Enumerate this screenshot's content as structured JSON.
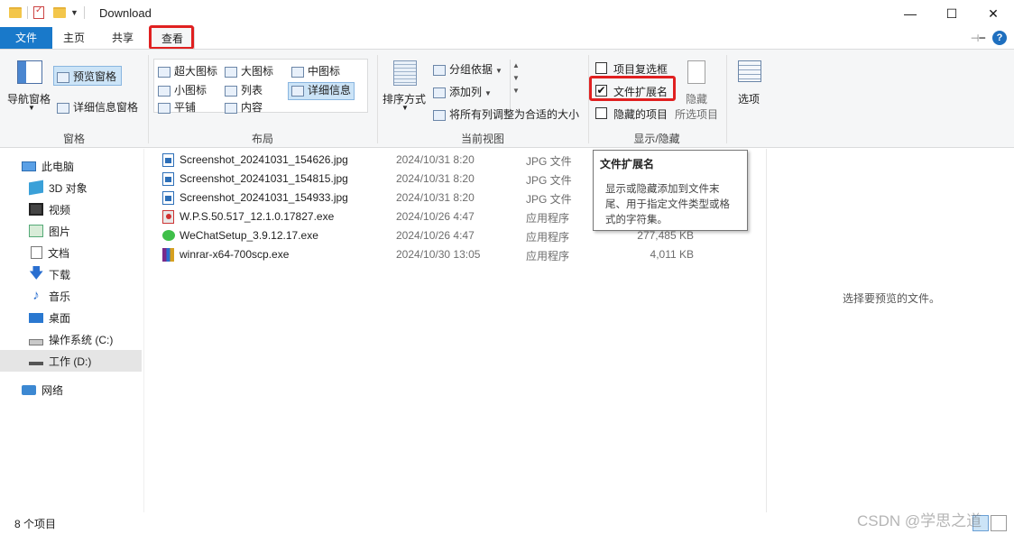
{
  "window": {
    "title": "Download",
    "minimize_glyph": "—",
    "maximize_glyph": "☐",
    "close_glyph": "✕"
  },
  "tabs": {
    "file": "文件",
    "home": "主页",
    "share": "共享",
    "view": "查看"
  },
  "ribbon": {
    "panes": {
      "nav_pane": "导航窗格",
      "preview_pane": "预览窗格",
      "details_pane": "详细信息窗格",
      "label": "窗格"
    },
    "layout": {
      "extra_large": "超大图标",
      "large": "大图标",
      "medium": "中图标",
      "small": "小图标",
      "list": "列表",
      "details": "详细信息",
      "tiles": "平铺",
      "content": "内容",
      "label": "布局"
    },
    "current_view": {
      "sort_by": "排序方式",
      "group_by": "分组依据",
      "add_columns": "添加列",
      "size_all_columns": "将所有列调整为合适的大小",
      "label": "当前视图"
    },
    "show_hide": {
      "item_checkboxes": "项目复选框",
      "file_extensions": "文件扩展名",
      "hidden_items": "隐藏的项目",
      "hide": "隐藏",
      "selected_items": "所选项目",
      "label": "显示/隐藏",
      "file_extensions_checked": true
    },
    "options": "选项"
  },
  "nav": {
    "items": [
      {
        "label": "此电脑",
        "icon": "computer-icon"
      },
      {
        "label": "3D 对象",
        "icon": "3d-objects-icon"
      },
      {
        "label": "视频",
        "icon": "video-icon"
      },
      {
        "label": "图片",
        "icon": "pictures-icon"
      },
      {
        "label": "文档",
        "icon": "documents-icon"
      },
      {
        "label": "下载",
        "icon": "download-icon"
      },
      {
        "label": "音乐",
        "icon": "music-icon"
      },
      {
        "label": "桌面",
        "icon": "desktop-icon"
      },
      {
        "label": "操作系统 (C:)",
        "icon": "drive-c-icon"
      },
      {
        "label": "工作 (D:)",
        "icon": "drive-d-icon"
      },
      {
        "label": "网络",
        "icon": "network-icon"
      }
    ]
  },
  "files": [
    {
      "name": "Screenshot_20241031_154626.jpg",
      "date": "2024/10/31 8:20",
      "type": "JPG 文件",
      "size": ""
    },
    {
      "name": "Screenshot_20241031_154815.jpg",
      "date": "2024/10/31 8:20",
      "type": "JPG 文件",
      "size": ""
    },
    {
      "name": "Screenshot_20241031_154933.jpg",
      "date": "2024/10/31 8:20",
      "type": "JPG 文件",
      "size": ""
    },
    {
      "name": "W.P.S.50.517_12.1.0.17827.exe",
      "date": "2024/10/26 4:47",
      "type": "应用程序",
      "size": ""
    },
    {
      "name": "WeChatSetup_3.9.12.17.exe",
      "date": "2024/10/26 4:47",
      "type": "应用程序",
      "size": "277,485 KB"
    },
    {
      "name": "winrar-x64-700scp.exe",
      "date": "2024/10/30 13:05",
      "type": "应用程序",
      "size": "4,011 KB"
    }
  ],
  "tooltip": {
    "title": "文件扩展名",
    "lines": [
      "显示或隐藏添加到文件末",
      "尾、用于指定文件类型或格",
      "式的字符集。"
    ]
  },
  "preview": {
    "empty_text": "选择要预览的文件。"
  },
  "status": {
    "item_count": "8 个项目"
  },
  "watermark": "CSDN @学思之道",
  "colors": {
    "accent": "#1979ca",
    "highlight_box": "#e02020",
    "selection": "#cce4f7"
  }
}
